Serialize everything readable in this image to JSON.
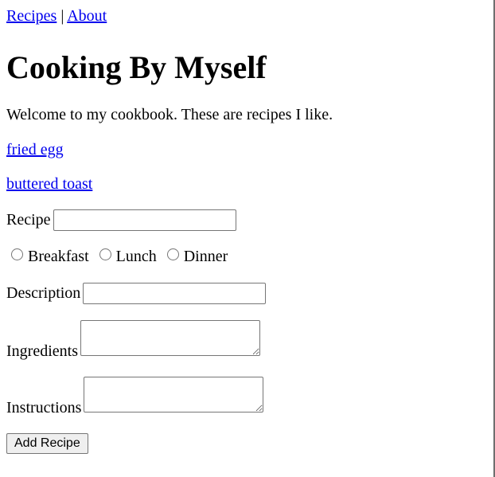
{
  "nav": {
    "recipes_label": "Recipes",
    "separator": "|",
    "about_label": "About"
  },
  "page": {
    "title": "Cooking By Myself",
    "intro": "Welcome to my cookbook. These are recipes I like."
  },
  "recipes": [
    {
      "label": "fried egg"
    },
    {
      "label": "buttered toast"
    }
  ],
  "form": {
    "recipe_label": "Recipe",
    "recipe_value": "",
    "meals": [
      {
        "label": "Breakfast"
      },
      {
        "label": "Lunch"
      },
      {
        "label": "Dinner"
      }
    ],
    "description_label": "Description",
    "description_value": "",
    "ingredients_label": "Ingredients",
    "instructions_label": "Instructions",
    "submit_label": "Add Recipe"
  },
  "colors": {
    "link": "#0000ee",
    "text": "#000000",
    "background": "#ffffff",
    "button_background": "#efefef"
  }
}
